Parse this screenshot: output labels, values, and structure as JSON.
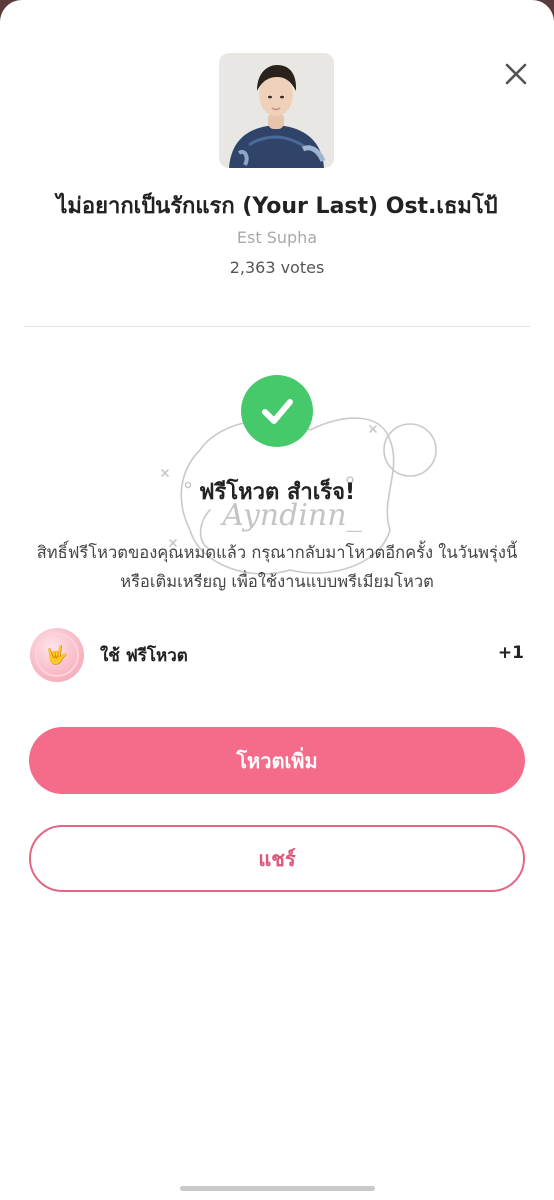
{
  "song": {
    "title": "ไม่อยากเป็นรักแรก (Your Last) Ost.เธมโป้",
    "artist": "Est Supha",
    "votes": "2,363 votes"
  },
  "close_icon": "close-icon",
  "success": {
    "icon": "check-circle-icon",
    "title": "ฟรีโหวต สำเร็จ!",
    "description": "สิทธิ์ฟรีโหวตของคุณหมดแล้ว กรุณากลับมาโหวตอีกครั้ง ในวันพรุ่งนี้ หรือเติมเหรียญ เพื่อใช้งานแบบพรีเมียมโหวต"
  },
  "watermark": {
    "text": "Ayndinn_"
  },
  "free_vote": {
    "icon": "coin-icon",
    "label": "ใช้ ฟรีโหวต",
    "count": "+1"
  },
  "buttons": {
    "vote_more": "โหวตเพิ่ม",
    "share": "แชร์"
  },
  "colors": {
    "accent": "#f56b8a",
    "success": "#45c96b",
    "share_border": "#e46685"
  }
}
